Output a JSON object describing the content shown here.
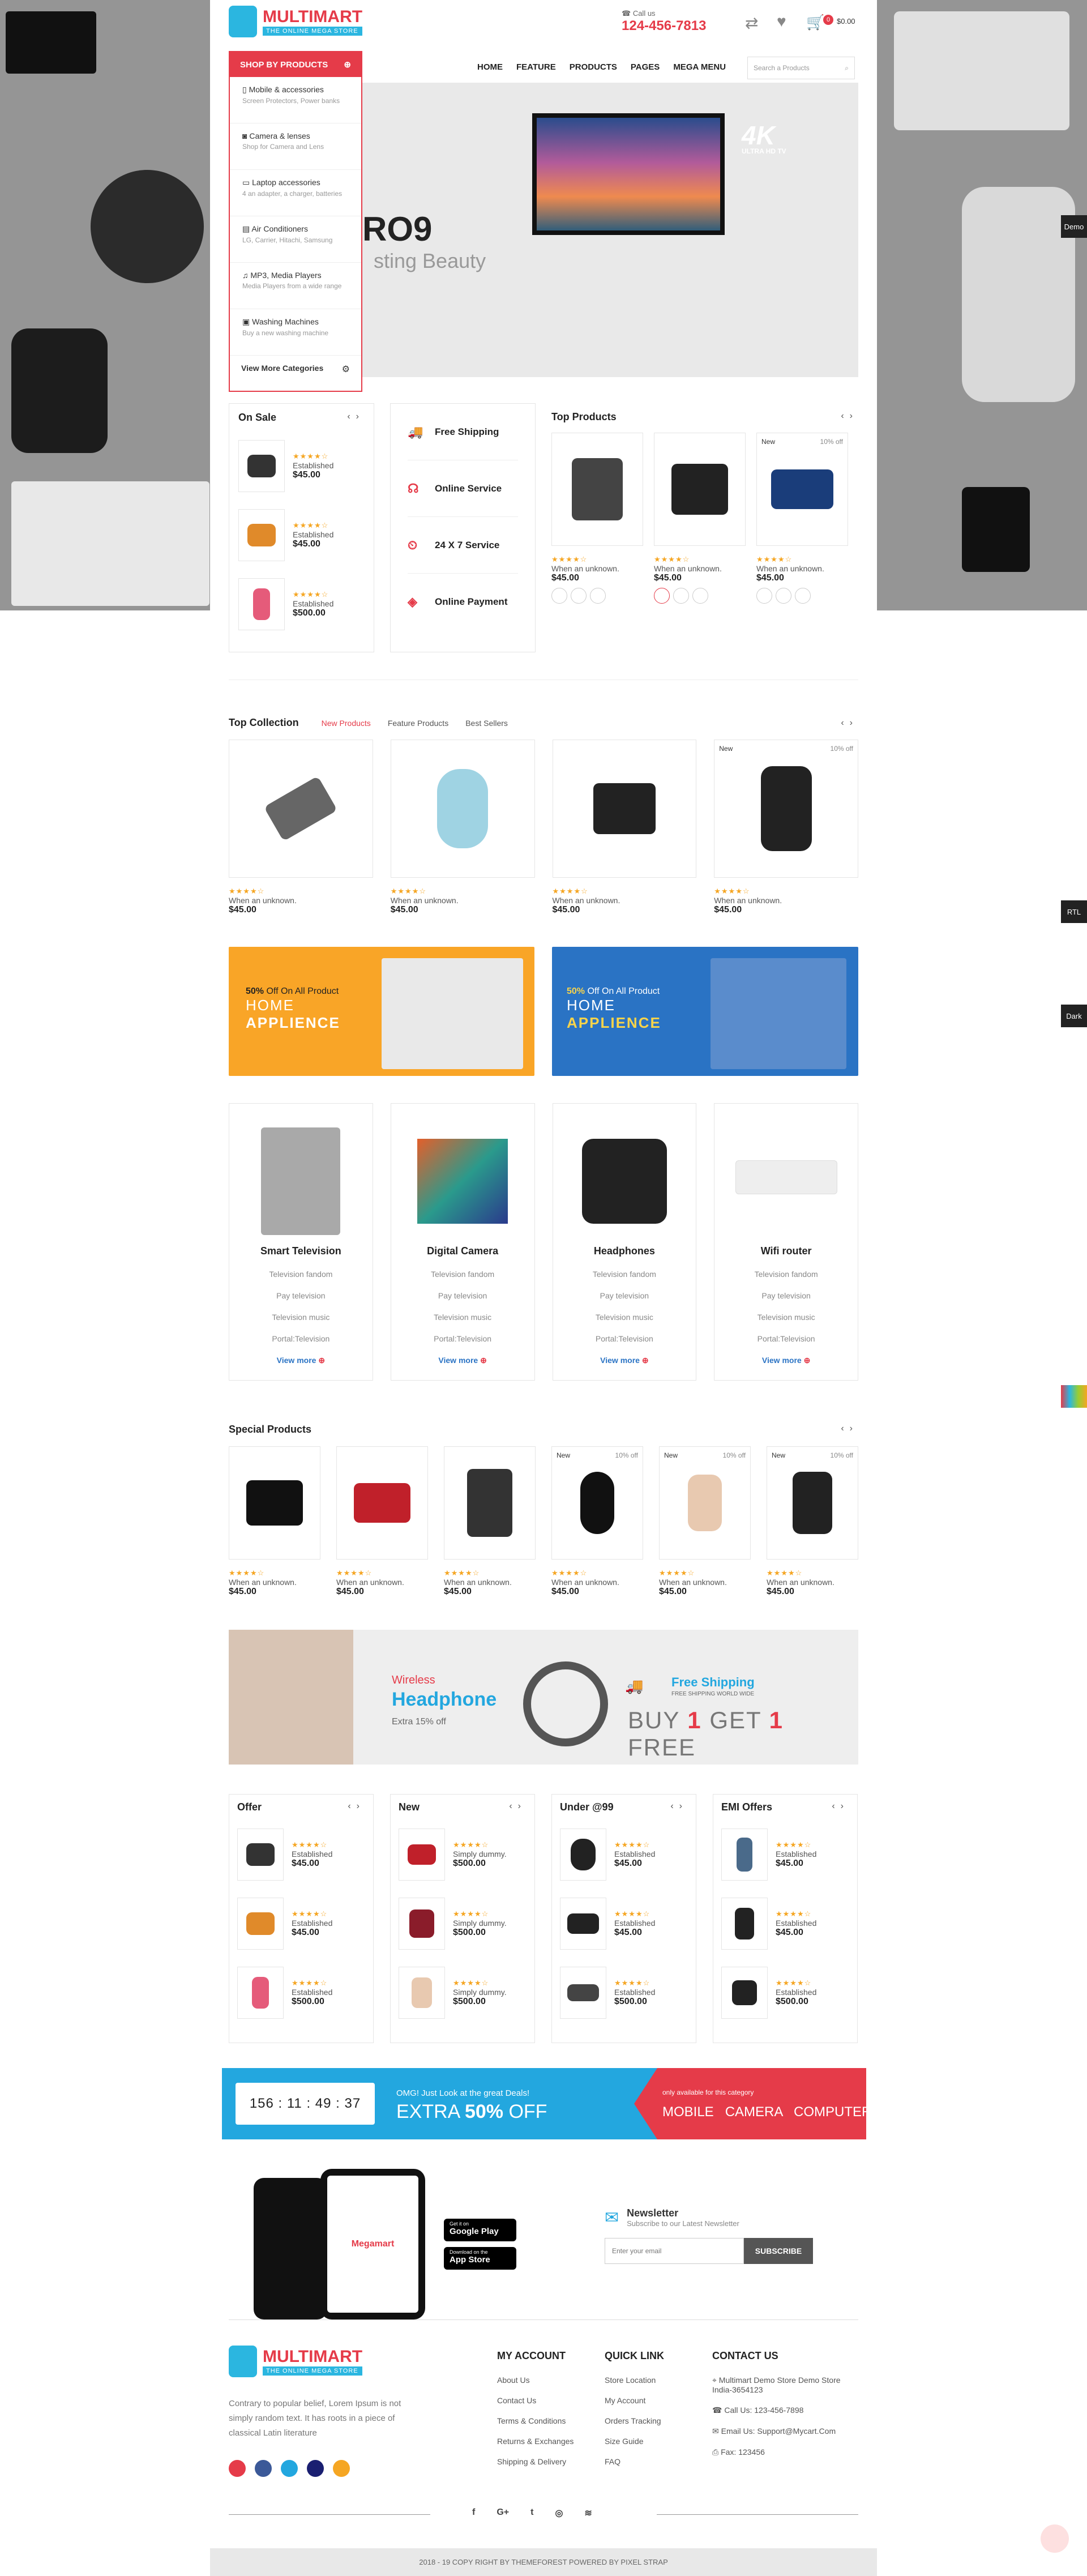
{
  "brand": {
    "name": "MULTIMART",
    "tagline": "THE ONLINE MEGA STORE",
    "call_label": "Call us",
    "phone": "124-456-7813",
    "cart_count": "0",
    "cart_total": "$0.00"
  },
  "nav": {
    "items": [
      "HOME",
      "FEATURE",
      "PRODUCTS",
      "PAGES",
      "MEGA MENU"
    ],
    "search_placeholder": "Search a Products"
  },
  "categories": {
    "header": "SHOP BY PRODUCTS",
    "items": [
      {
        "label": "Mobile & accessories",
        "sub": "Screen Protectors, Power banks"
      },
      {
        "label": "Camera & lenses",
        "sub": "Shop for Camera and Lens"
      },
      {
        "label": "Laptop accessories",
        "sub": "4 an adapter, a charger, batteries"
      },
      {
        "label": "Air Conditioners",
        "sub": "LG, Carrier, Hitachi, Samsung"
      },
      {
        "label": "MP3, Media Players",
        "sub": "Media Players from a wide range"
      },
      {
        "label": "Washing Machines",
        "sub": "Buy a new washing machine"
      }
    ],
    "more": "View More Categories"
  },
  "hero": {
    "title": "RO9",
    "subtitle": "sting Beauty",
    "tv_badge": "4K",
    "tv_sub": "ULTRA HD TV"
  },
  "side_tabs": [
    "Demo",
    "RTL",
    "Dark"
  ],
  "on_sale": {
    "title": "On Sale",
    "items": [
      {
        "label": "Established",
        "price": "$45.00"
      },
      {
        "label": "Established",
        "price": "$45.00"
      },
      {
        "label": "Established",
        "price": "$500.00"
      }
    ]
  },
  "services": [
    "Free Shipping",
    "Online Service",
    "24 X 7 Service",
    "Online Payment"
  ],
  "top_products": {
    "title": "Top Products",
    "items": [
      {
        "badge": "",
        "off": "",
        "label": "When an unknown.",
        "price": "$45.00"
      },
      {
        "badge": "",
        "off": "",
        "label": "When an unknown.",
        "price": "$45.00"
      },
      {
        "badge": "New",
        "off": "10% off",
        "label": "When an unknown.",
        "price": "$45.00"
      }
    ]
  },
  "top_collection": {
    "title": "Top Collection",
    "tabs": [
      "New Products",
      "Feature Products",
      "Best Sellers"
    ],
    "items": [
      {
        "badge": "",
        "off": "",
        "label": "When an unknown.",
        "price": "$45.00"
      },
      {
        "badge": "",
        "off": "",
        "label": "When an unknown.",
        "price": "$45.00"
      },
      {
        "badge": "",
        "off": "",
        "label": "When an unknown.",
        "price": "$45.00"
      },
      {
        "badge": "New",
        "off": "10% off",
        "label": "When an unknown.",
        "price": "$45.00"
      }
    ]
  },
  "banners": [
    {
      "pct": "50%",
      "pct_text": "Off On All Product",
      "line1": "HOME",
      "line2": "APPLIENCE"
    },
    {
      "pct": "50%",
      "pct_text": "Off On All Product",
      "line1": "HOME",
      "line2": "APPLIENCE"
    }
  ],
  "category_cards": [
    {
      "name": "Smart Television",
      "links": [
        "Television fandom",
        "Pay television",
        "Television music",
        "Portal:Television"
      ],
      "more": "View more"
    },
    {
      "name": "Digital Camera",
      "links": [
        "Television fandom",
        "Pay television",
        "Television music",
        "Portal:Television"
      ],
      "more": "View more"
    },
    {
      "name": "Headphones",
      "links": [
        "Television fandom",
        "Pay television",
        "Television music",
        "Portal:Television"
      ],
      "more": "View more"
    },
    {
      "name": "Wifi router",
      "links": [
        "Television fandom",
        "Pay television",
        "Television music",
        "Portal:Television"
      ],
      "more": "View more"
    }
  ],
  "special": {
    "title": "Special Products",
    "items": [
      {
        "badge": "",
        "off": "",
        "label": "When an unknown.",
        "price": "$45.00"
      },
      {
        "badge": "",
        "off": "",
        "label": "When an unknown.",
        "price": "$45.00"
      },
      {
        "badge": "",
        "off": "",
        "label": "When an unknown.",
        "price": "$45.00"
      },
      {
        "badge": "New",
        "off": "10% off",
        "label": "When an unknown.",
        "price": "$45.00"
      },
      {
        "badge": "New",
        "off": "10% off",
        "label": "When an unknown.",
        "price": "$45.00"
      },
      {
        "badge": "New",
        "off": "10% off",
        "label": "When an unknown.",
        "price": "$45.00"
      }
    ]
  },
  "wireless": {
    "kicker": "Wireless",
    "headline": "Headphone",
    "extra": "Extra 15% off",
    "ship": "Free Shipping",
    "ship_sub": "FREE SHIPPING WORLD WIDE",
    "buy": "BUY",
    "one_a": "1",
    "get": "GET",
    "one_b": "1",
    "free": "FREE"
  },
  "mini_lists": [
    {
      "title": "Offer",
      "items": [
        {
          "label": "Established",
          "price": "$45.00"
        },
        {
          "label": "Established",
          "price": "$45.00"
        },
        {
          "label": "Established",
          "price": "$500.00"
        }
      ]
    },
    {
      "title": "New",
      "items": [
        {
          "label": "Simply dummy.",
          "price": "$500.00"
        },
        {
          "label": "Simply dummy.",
          "price": "$500.00"
        },
        {
          "label": "Simply dummy.",
          "price": "$500.00"
        }
      ]
    },
    {
      "title": "Under @99",
      "items": [
        {
          "label": "Established",
          "price": "$45.00"
        },
        {
          "label": "Established",
          "price": "$45.00"
        },
        {
          "label": "Established",
          "price": "$500.00"
        }
      ]
    },
    {
      "title": "EMI Offers",
      "items": [
        {
          "label": "Established",
          "price": "$45.00"
        },
        {
          "label": "Established",
          "price": "$45.00"
        },
        {
          "label": "Established",
          "price": "$500.00"
        }
      ]
    }
  ],
  "countdown": {
    "timer": "156 : 11 : 49 : 37",
    "promo": "OMG! Just Look at the great Deals!",
    "extra": "EXTRA",
    "pct": "50%",
    "off": "OFF",
    "only": "only available for this category",
    "cats": "MOBILE   CAMERA   COMPUTER"
  },
  "app": {
    "google": "Google Play",
    "apple": "App Store",
    "google_pre": "Get it on",
    "apple_pre": "Download on the",
    "phone_brand": "Megamart"
  },
  "newsletter": {
    "title": "Newsletter",
    "sub": "Subscribe to our Latest Newsletter",
    "placeholder": "Enter your email",
    "button": "SUBSCRIBE"
  },
  "footer": {
    "about": "Contrary to popular belief, Lorem Ipsum is not simply random text. It has roots in a piece of classical Latin literature",
    "account": {
      "title": "MY ACCOUNT",
      "links": [
        "About Us",
        "Contact Us",
        "Terms & Conditions",
        "Returns & Exchanges",
        "Shipping & Delivery"
      ]
    },
    "quick": {
      "title": "QUICK LINK",
      "links": [
        "Store Location",
        "My Account",
        "Orders Tracking",
        "Size Guide",
        "FAQ"
      ]
    },
    "contact": {
      "title": "CONTACT US",
      "address": "Multimart Demo Store Demo Store India-3654123",
      "phone": "Call Us: 123-456-7898",
      "email": "Email Us: Support@Mycart.Com",
      "fax": "Fax: 123456"
    },
    "copyright": "2018 - 19 COPY RIGHT BY THEMEFOREST POWERED BY PIXEL STRAP"
  },
  "colors": {
    "accent": "#e53b49",
    "brand_blue": "#2bb6e0",
    "star": "#f5a623"
  }
}
